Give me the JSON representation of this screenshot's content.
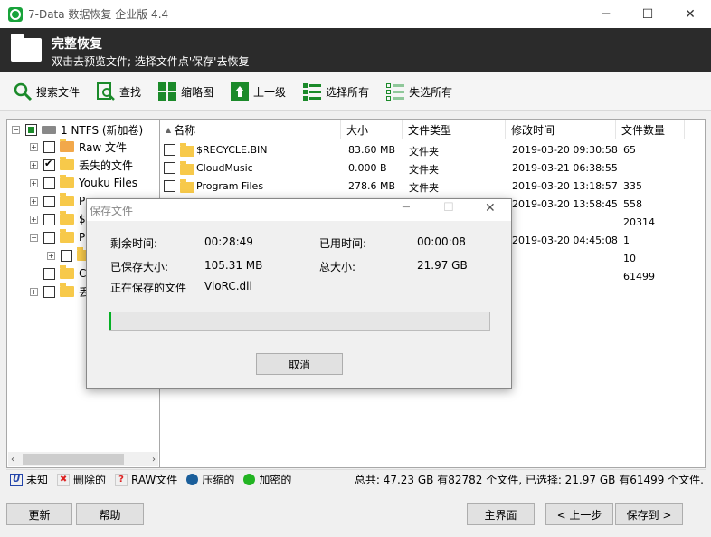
{
  "window": {
    "title": "7-Data 数据恢复 企业版 4.4"
  },
  "header": {
    "title": "完整恢复",
    "subtitle": "双击去预览文件; 选择文件点'保存'去恢复"
  },
  "toolbar": {
    "search_files": "搜索文件",
    "find": "查找",
    "thumbnails": "缩略图",
    "up_level": "上一级",
    "select_all": "选择所有",
    "deselect_all": "失选所有"
  },
  "tree": {
    "root": "1 NTFS (新加卷)",
    "items": [
      {
        "label": "Raw 文件"
      },
      {
        "label": "丢失的文件"
      },
      {
        "label": "Youku Files"
      },
      {
        "label": "Pr"
      },
      {
        "label": "$"
      },
      {
        "label": "P"
      },
      {
        "label": ""
      },
      {
        "label": "C"
      },
      {
        "label": "丢"
      }
    ]
  },
  "list": {
    "columns": [
      "名称",
      "大小",
      "文件类型",
      "修改时间",
      "文件数量"
    ],
    "rows": [
      {
        "name": "$RECYCLE.BIN",
        "size": "83.60 MB",
        "type": "文件夹",
        "modified": "2019-03-20 09:30:58",
        "count": "65"
      },
      {
        "name": "CloudMusic",
        "size": "0.000 B",
        "type": "文件夹",
        "modified": "2019-03-21 06:38:55",
        "count": ""
      },
      {
        "name": "Program Files",
        "size": "278.6 MB",
        "type": "文件夹",
        "modified": "2019-03-20 13:18:57",
        "count": "335"
      },
      {
        "name": "",
        "size": "",
        "type": "",
        "modified": "2019-03-20 13:58:45",
        "count": "558"
      },
      {
        "name": "",
        "size": "",
        "type": "",
        "modified": "",
        "count": "20314"
      },
      {
        "name": "",
        "size": "",
        "type": "",
        "modified": "2019-03-20 04:45:08",
        "count": "1"
      },
      {
        "name": "",
        "size": "",
        "type": "",
        "modified": "",
        "count": "10"
      },
      {
        "name": "",
        "size": "",
        "type": "",
        "modified": "",
        "count": "61499"
      }
    ]
  },
  "legend": {
    "unknown": "未知",
    "deleted": "删除的",
    "raw": "RAW文件",
    "compressed": "压缩的",
    "encrypted": "加密的",
    "summary": "总共: 47.23 GB 有82782 个文件, 已选择: 21.97 GB 有61499 个文件."
  },
  "buttons": {
    "refresh": "更新",
    "help": "帮助",
    "main": "主界面",
    "back": "< 上一步",
    "save_to": "保存到 >"
  },
  "dialog": {
    "title": "保存文件",
    "remaining_label": "剩余时间:",
    "remaining_value": "00:28:49",
    "elapsed_label": "已用时间:",
    "elapsed_value": "00:00:08",
    "saved_label": "已保存大小:",
    "saved_value": "105.31 MB",
    "total_label": "总大小:",
    "total_value": "21.97 GB",
    "current_label": "正在保存的文件",
    "current_value": "VioRC.dll",
    "progress_fraction": 0.005,
    "cancel": "取消"
  },
  "colors": {
    "accent": "#1b8a2a",
    "header_bg": "#2b2b2b",
    "progress": "#06b025"
  }
}
